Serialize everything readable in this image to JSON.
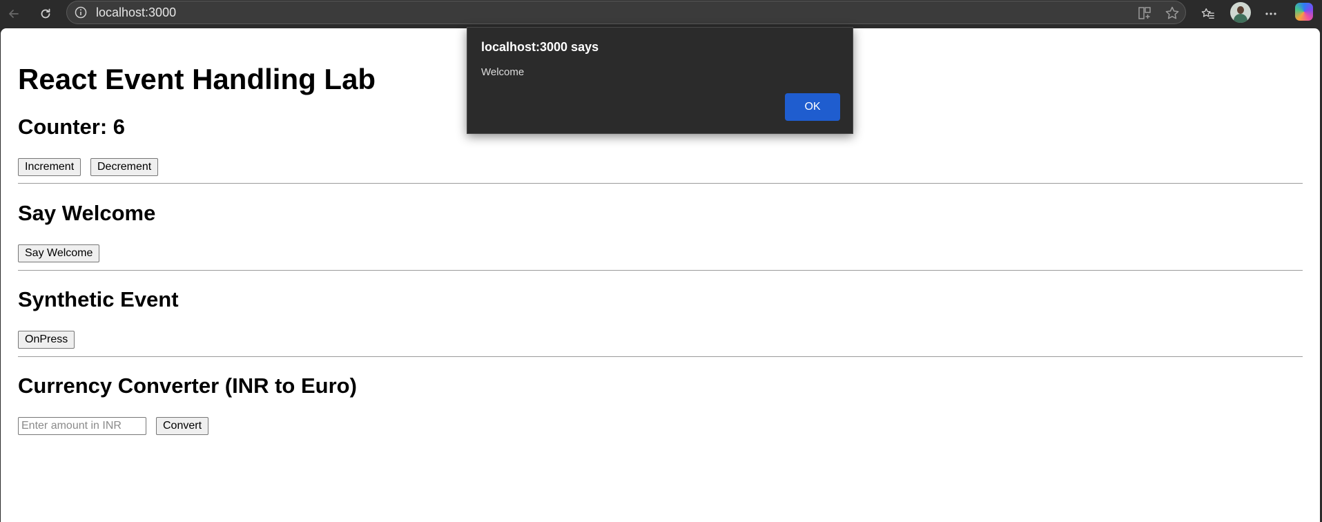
{
  "browser": {
    "url": "localhost:3000",
    "icons": [
      "back-arrow-icon",
      "refresh-icon",
      "site-info-icon",
      "split-screen-icon",
      "favorite-star-icon",
      "favorites-icon",
      "profile-avatar",
      "more-options-icon",
      "copilot-icon"
    ]
  },
  "page": {
    "title": "React Event Handling Lab",
    "counter": {
      "heading": "Counter: 6",
      "increment_label": "Increment",
      "decrement_label": "Decrement"
    },
    "welcome": {
      "heading": "Say Welcome",
      "button_label": "Say Welcome"
    },
    "synthetic": {
      "heading": "Synthetic Event",
      "button_label": "OnPress"
    },
    "converter": {
      "heading": "Currency Converter (INR to Euro)",
      "input_value": "",
      "input_placeholder": "Enter amount in INR",
      "button_label": "Convert"
    }
  },
  "dialog": {
    "title": "localhost:3000 says",
    "message": "Welcome",
    "ok_label": "OK",
    "accent": "#1f5dcf"
  }
}
